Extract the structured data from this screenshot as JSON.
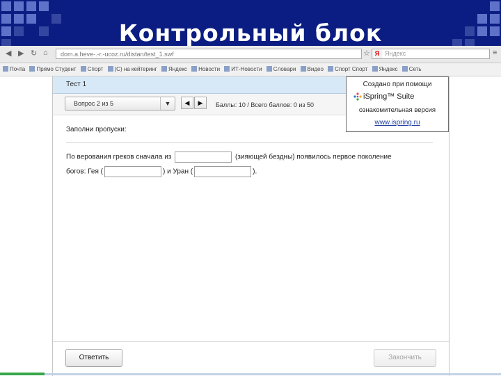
{
  "slide": {
    "title": "Контрольный блок"
  },
  "browser": {
    "address": "dom.a.heve-.-r.-ucoz.ru/distan/test_1.swf",
    "search_placeholder": "Яндекс"
  },
  "bookmarks": [
    "Почта",
    "Прямо Студент",
    "Спорт",
    "(C) на кейтеринг",
    "Яндекс",
    "Новости",
    "ИТ-Новости ",
    "Словари",
    "Видео",
    "Спорт Спорт",
    "Яндекс",
    "Сеть"
  ],
  "quiz": {
    "title": "Тест 1",
    "question_select": "Вопрос 2 из 5",
    "prev_glyph": "◀",
    "next_glyph": "▶",
    "score_label": "Баллы: 10 / Всего баллов: 0 из 50",
    "prompt": "Заполни пропуски:",
    "line1_before": "По верования греков сначала из",
    "line1_after": "(зияющей бездны) появилось первое поколение",
    "line2_start": "богов: Гея (",
    "line2_mid": ") и Уран (",
    "line2_end": ").",
    "submit_button": "Ответить",
    "finish_button": "Закончить"
  },
  "watermark": {
    "line1": "Создано при помощи",
    "brand": "iSpring™ Suite",
    "line3": "ознакомительная версия",
    "link": "www.ispring.ru"
  },
  "colors": {
    "slide_header": "#0b1d82",
    "quiz_titlebar": "#d7e8f7",
    "link": "#1f3fa0"
  }
}
